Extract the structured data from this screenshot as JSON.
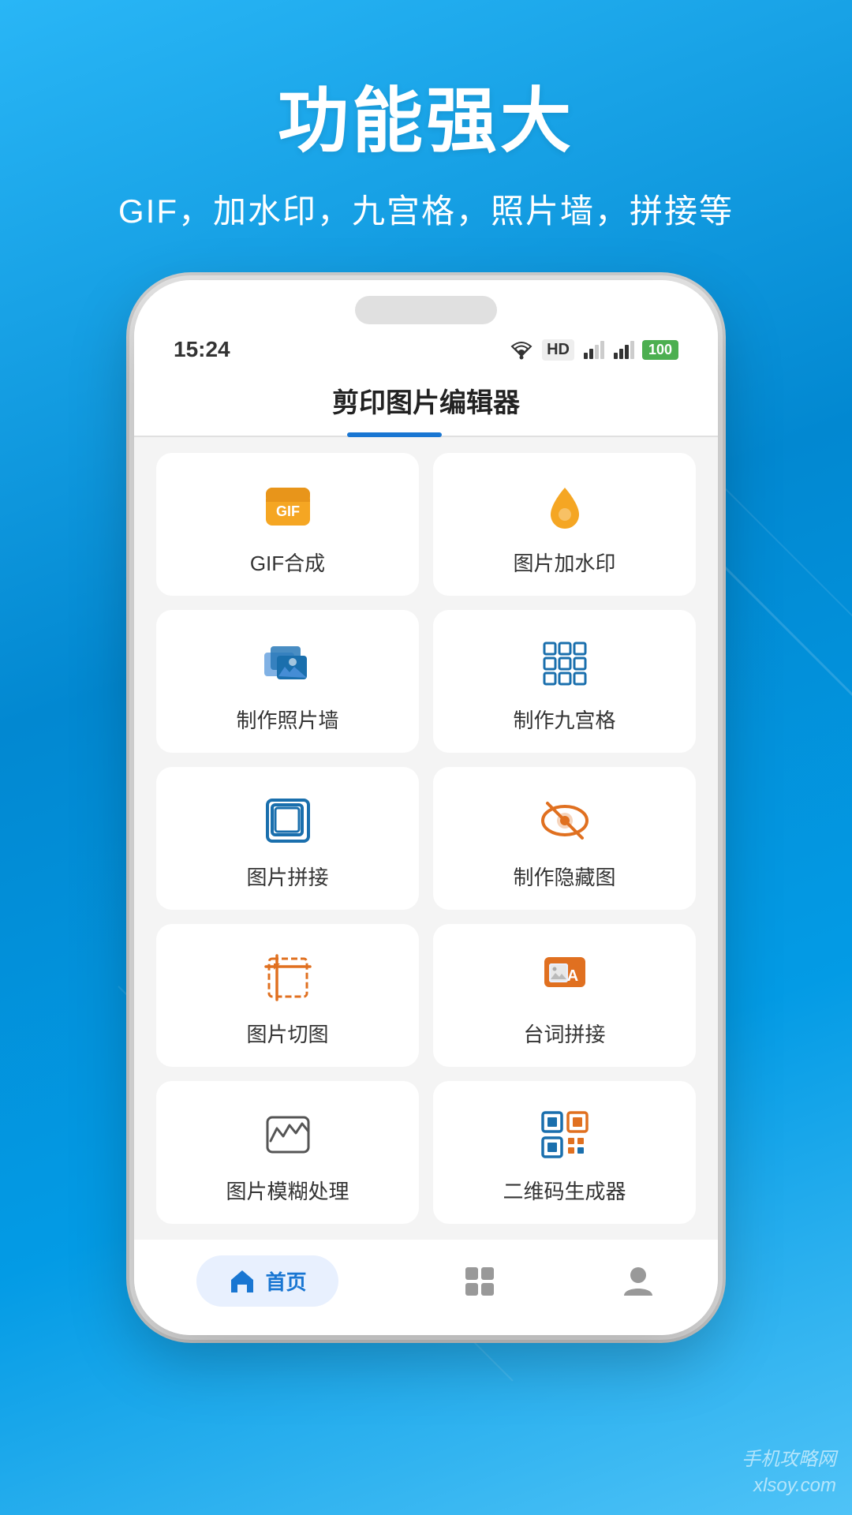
{
  "background": {
    "gradient_start": "#29b6f6",
    "gradient_end": "#0288d1"
  },
  "header": {
    "title": "功能强大",
    "subtitle": "GIF，加水印，九宫格，照片墙，拼接等"
  },
  "status_bar": {
    "time": "15:24",
    "battery": "100"
  },
  "app": {
    "title": "剪印图片编辑器"
  },
  "features": [
    {
      "id": "gif",
      "label": "GIF合成",
      "icon": "gif"
    },
    {
      "id": "watermark",
      "label": "图片加水印",
      "icon": "watermark"
    },
    {
      "id": "photo_wall",
      "label": "制作照片墙",
      "icon": "photo_wall"
    },
    {
      "id": "nine_grid",
      "label": "制作九宫格",
      "icon": "nine_grid"
    },
    {
      "id": "stitch",
      "label": "图片拼接",
      "icon": "stitch"
    },
    {
      "id": "hidden",
      "label": "制作隐藏图",
      "icon": "hidden"
    },
    {
      "id": "crop",
      "label": "图片切图",
      "icon": "crop"
    },
    {
      "id": "dialogue",
      "label": "台词拼接",
      "icon": "dialogue"
    },
    {
      "id": "blur",
      "label": "图片模糊处理",
      "icon": "blur"
    },
    {
      "id": "qrcode",
      "label": "二维码生成器",
      "icon": "qrcode"
    }
  ],
  "bottom_nav": [
    {
      "id": "home",
      "label": "首页",
      "icon": "home",
      "active": true
    },
    {
      "id": "tools",
      "label": "",
      "icon": "grid",
      "active": false
    },
    {
      "id": "profile",
      "label": "",
      "icon": "person",
      "active": false
    }
  ],
  "watermark": "手机攻略网\nxlsoy.com"
}
